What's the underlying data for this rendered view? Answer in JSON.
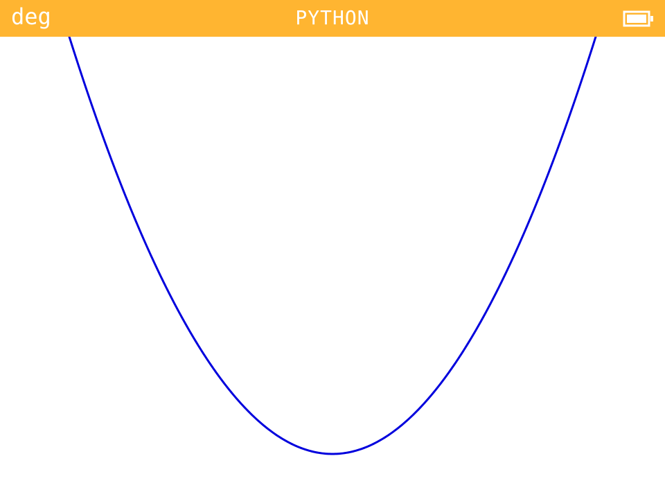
{
  "status_bar": {
    "angle_mode": "deg",
    "title": "PYTHON",
    "background_color": "#ffb531",
    "text_color": "#ffffff",
    "battery_icon": "battery-full-icon"
  },
  "plot": {
    "curve": "parabola",
    "curve_color": "#0000dd",
    "background_color": "#ffffff"
  }
}
